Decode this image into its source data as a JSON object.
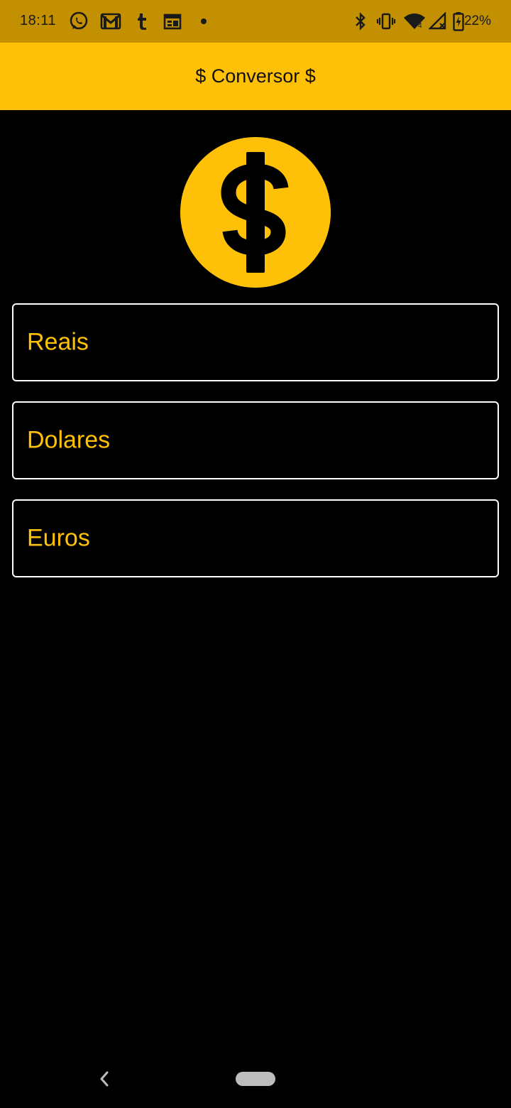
{
  "status_bar": {
    "time": "18:11",
    "battery_text": "22%",
    "icons_left": [
      "whatsapp-icon",
      "gmail-icon",
      "tumblr-icon",
      "calendar-icon",
      "dot-icon"
    ],
    "icons_right": [
      "bluetooth-icon",
      "vibrate-icon",
      "wifi-icon",
      "signal-icon",
      "battery-charging-icon"
    ],
    "background": "#C29000"
  },
  "app_bar": {
    "title": "$ Conversor $",
    "background": "#FFC107"
  },
  "logo": {
    "icon": "dollar-coin-icon",
    "color": "#FFC107"
  },
  "fields": [
    {
      "label": "Reais",
      "value": ""
    },
    {
      "label": "Dolares",
      "value": ""
    },
    {
      "label": "Euros",
      "value": ""
    }
  ],
  "nav_bar": {
    "icons": [
      "back-icon",
      "home-pill"
    ]
  },
  "colors": {
    "accent": "#FFC107",
    "background": "#000000",
    "field_border": "#FFFFFF"
  }
}
